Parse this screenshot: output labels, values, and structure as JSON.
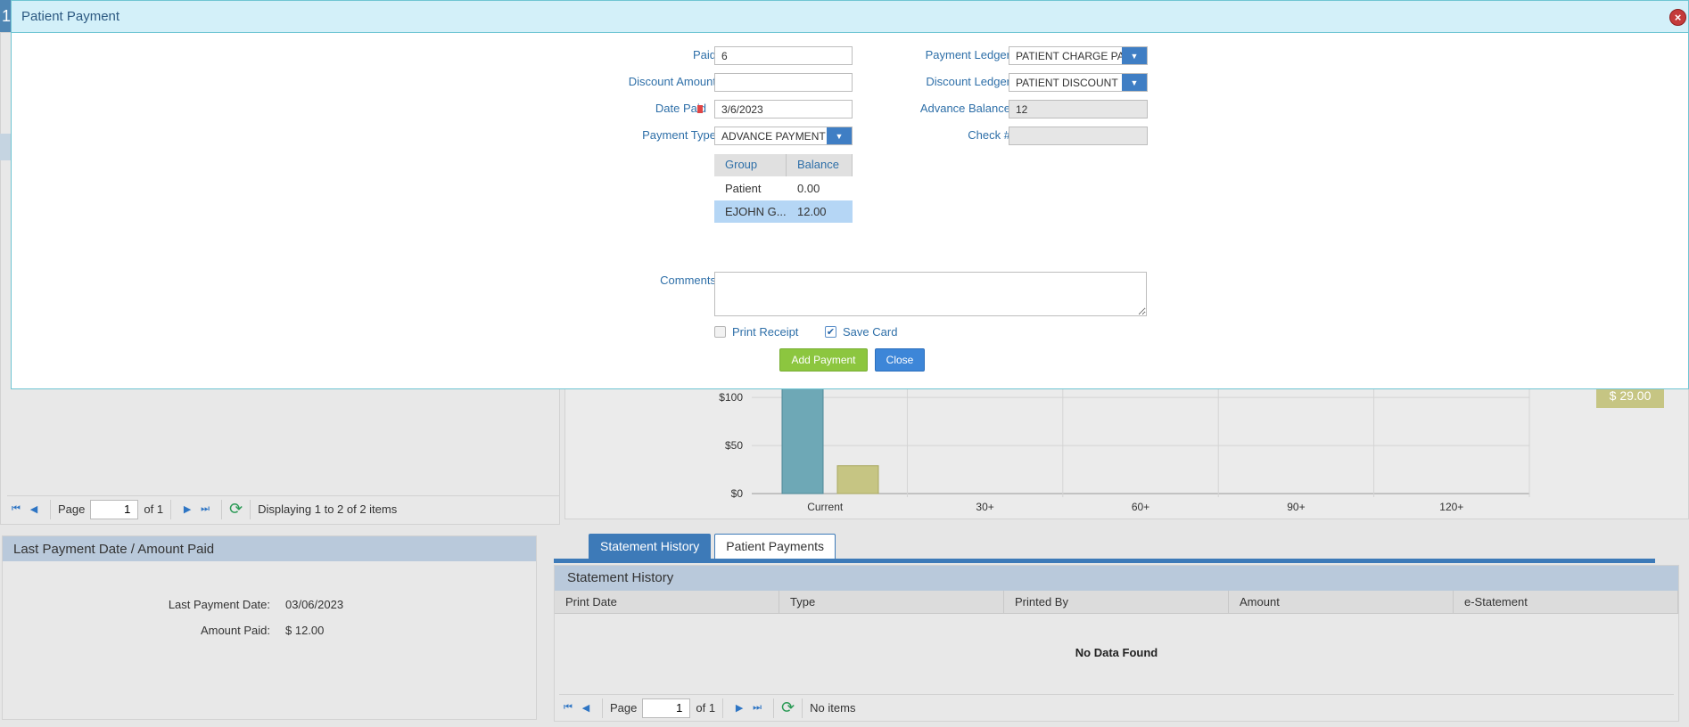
{
  "background": {
    "tab_number": "1",
    "left_pager": {
      "page_label": "Page",
      "page_value": "1",
      "of_label": "of 1",
      "display_text": "Displaying 1 to 2 of 2 items"
    },
    "chart_legend_value": "$ 29.00"
  },
  "chart_data": {
    "type": "bar",
    "categories": [
      "Current",
      "30+",
      "60+",
      "90+",
      "120+"
    ],
    "series": [
      {
        "values": [
          115,
          0,
          0,
          0,
          0
        ],
        "color": "#6ea8b6"
      },
      {
        "values": [
          29,
          0,
          0,
          0,
          0
        ],
        "color": "#c6c583"
      }
    ],
    "y_ticks": [
      "$0",
      "$50",
      "$100"
    ],
    "ylim": [
      0,
      115
    ],
    "grid": true
  },
  "last_payment": {
    "title": "Last Payment Date / Amount Paid",
    "date_label": "Last Payment Date:",
    "date_value": "03/06/2023",
    "amount_label": "Amount Paid:",
    "amount_value": "$ 12.00"
  },
  "tabs": [
    {
      "label": "Statement History",
      "active": true
    },
    {
      "label": "Patient Payments",
      "active": false
    }
  ],
  "statement_history": {
    "title": "Statement History",
    "columns": [
      "Print Date",
      "Type",
      "Printed By",
      "Amount",
      "e-Statement"
    ],
    "empty_text": "No Data Found",
    "pager": {
      "page_label": "Page",
      "page_value": "1",
      "of_label": "of 1",
      "display_text": "No items"
    }
  },
  "modal": {
    "title": "Patient Payment",
    "close_icon": "×",
    "fields": {
      "paid_label": "Paid",
      "paid_value": "6",
      "discount_amount_label": "Discount Amount",
      "discount_amount_value": "",
      "date_paid_label": "Date Paid",
      "date_paid_value": "3/6/2023",
      "payment_type_label": "Payment Type",
      "payment_type_value": "ADVANCE PAYMENT",
      "payment_ledger_label": "Payment Ledger",
      "payment_ledger_value": "PATIENT CHARGE PAY",
      "discount_ledger_label": "Discount Ledger",
      "discount_ledger_value": "PATIENT DISCOUNT",
      "advance_balance_label": "Advance Balance",
      "advance_balance_value": "12",
      "check_label": "Check #",
      "check_value": "",
      "comments_label": "Comments",
      "comments_value": ""
    },
    "group_table": {
      "headers": [
        "Group",
        "Balance"
      ],
      "rows": [
        {
          "group": "Patient",
          "balance": "0.00",
          "selected": false
        },
        {
          "group": "EJOHN G...",
          "balance": "12.00",
          "selected": true
        }
      ]
    },
    "print_receipt_label": "Print Receipt",
    "print_receipt_checked": false,
    "save_card_label": "Save Card",
    "save_card_checked": true,
    "add_payment_label": "Add Payment",
    "close_label": "Close"
  }
}
